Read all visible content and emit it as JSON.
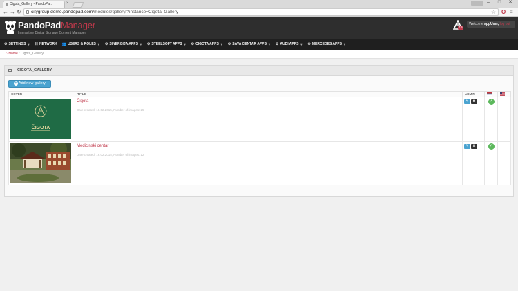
{
  "browser": {
    "tab_title": "Cigota_Gallery - PandoPa...",
    "url_host": "citygroup.demo.pandopad.com",
    "url_path": "/modules/gallery/?instance=Cigota_Gallery"
  },
  "header": {
    "logo_main": "PandoPad",
    "logo_accent": "Manager",
    "logo_sub": "Interactive Digital Signage Content Manager",
    "notification_count": "19",
    "welcome_label": "Welcome ",
    "username": "appUser,",
    "logout_label": " log out"
  },
  "nav": {
    "items": [
      {
        "label": "SETTINGS",
        "icon": "gear-icon"
      },
      {
        "label": "NETWORK",
        "icon": "network-icon"
      },
      {
        "label": "USERS & ROLES",
        "icon": "users-icon"
      },
      {
        "label": "SINERGIJA APPS",
        "icon": "gears-icon"
      },
      {
        "label": "STEELSOFT APPS",
        "icon": "gears-icon"
      },
      {
        "label": "CIGOTA APPS",
        "icon": "gears-icon"
      },
      {
        "label": "SAVA CENTAR APPS",
        "icon": "gears-icon"
      },
      {
        "label": "AUDI APPS",
        "icon": "gears-icon"
      },
      {
        "label": "MERCEDES APPS",
        "icon": "gears-icon"
      }
    ]
  },
  "breadcrumb": {
    "home": "Home",
    "separator": " / ",
    "current": "Cigota_Gallery"
  },
  "panel": {
    "title": "CIGOTA_GALLERY",
    "add_button": "Add new gallery"
  },
  "table": {
    "headers": {
      "cover": "COVER",
      "title": "TITLE",
      "admin": "ADMIN"
    },
    "rows": [
      {
        "title": "Čigota",
        "meta": "Date created: 16.02.2015, Number of images: 25",
        "cover_text": "ČIGOTA"
      },
      {
        "title": "Medicinski centar",
        "meta": "Date created: 16.02.2015, Number of images: 12",
        "cover_text": ""
      }
    ]
  },
  "colors": {
    "accent": "#c0394b",
    "primary_button": "#4aa3d0",
    "success": "#5cb85c",
    "header_bg": "#2e2e2e",
    "nav_bg": "#1f1f1f",
    "cigota_green": "#1f6b45"
  }
}
